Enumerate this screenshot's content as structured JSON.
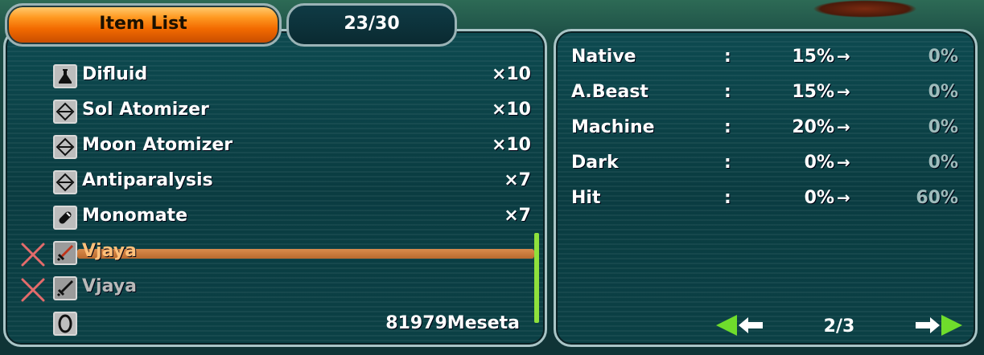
{
  "tabs": {
    "item_list": "Item List",
    "count": "23/30"
  },
  "items": [
    {
      "name": "Difluid",
      "qty": "×10",
      "icon": "flask-icon",
      "mark": ""
    },
    {
      "name": "Sol Atomizer",
      "qty": "×10",
      "icon": "atomizer-icon",
      "mark": ""
    },
    {
      "name": "Moon Atomizer",
      "qty": "×10",
      "icon": "atomizer-icon",
      "mark": ""
    },
    {
      "name": "Antiparalysis",
      "qty": "×7",
      "icon": "atomizer-icon",
      "mark": ""
    },
    {
      "name": "Monomate",
      "qty": "×7",
      "icon": "capsule-icon",
      "mark": ""
    },
    {
      "name": "Vjaya",
      "qty": "",
      "icon": "sword-icon",
      "mark": "unusable-x-icon"
    },
    {
      "name": "Vjaya",
      "qty": "",
      "icon": "sword-icon",
      "mark": "unusable-x-icon"
    }
  ],
  "meseta": {
    "icon": "meseta-icon",
    "value": "81979Meseta"
  },
  "stats": [
    {
      "name": "Native",
      "colon": ":",
      "current": "15%",
      "arrow": "→",
      "new": "0%"
    },
    {
      "name": "A.Beast",
      "colon": ":",
      "current": "15%",
      "arrow": "→",
      "new": "0%"
    },
    {
      "name": "Machine",
      "colon": ":",
      "current": "20%",
      "arrow": "→",
      "new": "0%"
    },
    {
      "name": "Dark",
      "colon": ":",
      "current": "0%",
      "arrow": "→",
      "new": "0%"
    },
    {
      "name": "Hit",
      "colon": ":",
      "current": "0%",
      "arrow": "→",
      "new": "60%"
    }
  ],
  "pager": {
    "page": "2/3",
    "prev_icon": "arrow-left-icon",
    "next_icon": "arrow-right-icon"
  },
  "colors": {
    "accent": "#f26a00",
    "highlight": "#d98b4c",
    "scrollbar": "#8fe03c",
    "arrow_green": "#6fdc2c"
  }
}
